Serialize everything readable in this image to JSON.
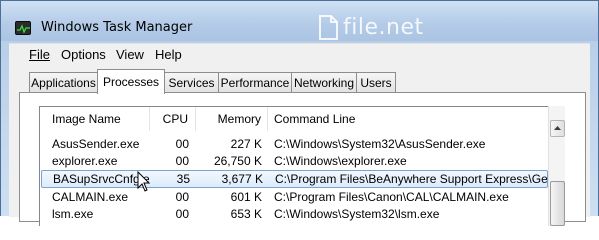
{
  "window": {
    "title": "Windows Task Manager",
    "watermark": "file.net"
  },
  "menu": [
    "File",
    "Options",
    "View",
    "Help"
  ],
  "tabs": [
    "Applications",
    "Processes",
    "Services",
    "Performance",
    "Networking",
    "Users"
  ],
  "active_tab": "Processes",
  "columns": [
    "Image Name",
    "CPU",
    "Memory",
    "Command Line"
  ],
  "rows": [
    {
      "image": "AsusSender.exe",
      "cpu": "00",
      "memory": "227 K",
      "cmd": "C:\\Windows\\System32\\AsusSender.exe"
    },
    {
      "image": "explorer.exe",
      "cpu": "00",
      "memory": "26,750 K",
      "cmd": "C:\\Windows\\explorer.exe"
    },
    {
      "image": "BASupSrvcCnfg.exe",
      "cpu": "35",
      "memory": "3,677 K",
      "cmd": "C:\\Program Files\\BeAnywhere Support Express\\Get...",
      "selected": true
    },
    {
      "image": "CALMAIN.exe",
      "cpu": "00",
      "memory": "601 K",
      "cmd": "C:\\Program Files\\Canon\\CAL\\CALMAIN.exe"
    },
    {
      "image": "lsm.exe",
      "cpu": "00",
      "memory": "653 K",
      "cmd": "C:\\Windows\\System32\\lsm.exe"
    }
  ],
  "icons": {
    "app": "task-manager-icon",
    "watermark": "file-net-logo-icon",
    "cursor": "mouse-pointer-icon"
  },
  "colors": {
    "selection_border": "#7da2ce",
    "selection_fill": "#dcebfc",
    "titlebar": "#b9cfe9"
  }
}
